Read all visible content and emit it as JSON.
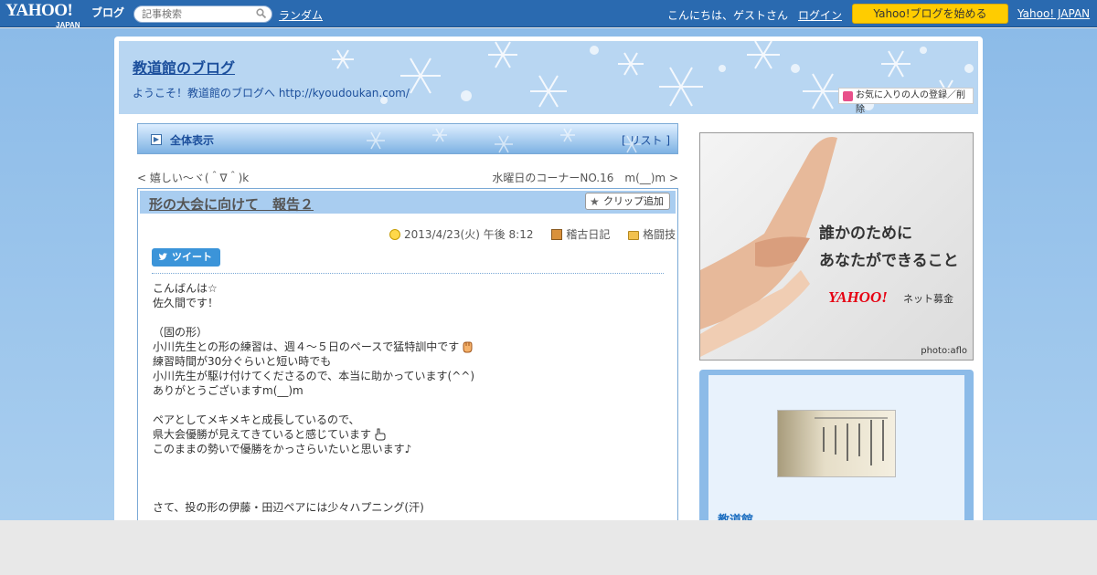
{
  "topbar": {
    "logo": "YAHOO!",
    "logo_sub": "JAPAN",
    "logo_blog": "ブログ",
    "search_placeholder": "記事検索",
    "random_link": "ランダム",
    "greeting": "こんにちは、ゲストさん",
    "login": "ログイン",
    "start_blog": "Yahoo!ブログを始める",
    "yahoo_japan": "Yahoo! JAPAN"
  },
  "header": {
    "blog_title": "教道館のブログ",
    "welcome": "ようこそ！教道館のブログへ http://kyoudoukan.com/",
    "favorite_button": "お気に入りの人の登録／削除"
  },
  "nav": {
    "all_label": "全体表示",
    "list_open": "[ ",
    "list_link": "リスト",
    "list_close": " ]",
    "prev_prefix": "< ",
    "prev_link": "嬉しい～ヾ(＾∇＾)k",
    "next_link": "水曜日のコーナーNO.16　m(__)m",
    "next_suffix": " >"
  },
  "article": {
    "title": "形の大会に向けて　報告２",
    "clip_button": "クリップ追加",
    "date": "2013/4/23(火) 午後 8:12",
    "category": "稽古日記",
    "folder": "格闘技",
    "tweet_button": "ツイート",
    "lines": [
      "こんばんは☆",
      "佐久間です！",
      "",
      "（固の形）",
      "小川先生との形の練習は、週４～５日のペースで猛特訓中です",
      "練習時間が30分ぐらいと短い時でも",
      "小川先生が駆け付けてくださるので、本当に助かっています(^^)",
      "ありがとうございますm(__)m",
      "",
      "ペアとしてメキメキと成長しているので、",
      "県大会優勝が見えてきていると感じています",
      "このままの勢いで優勝をかっさらいたいと思います♪",
      "",
      "",
      "",
      "さて、投の形の伊藤・田辺ペアには少々ハプニング(汗)"
    ]
  },
  "ad": {
    "line1": "誰かのために",
    "line2": "あなたができること",
    "logo": "YAHOO!",
    "logo_sub": "ネット募金",
    "credit": "photo:aflo"
  },
  "profile": {
    "name": "教道館"
  },
  "icons": {
    "search": "search-icon",
    "favorite": "heart-icon",
    "clip": "star-icon",
    "date": "clock-icon",
    "category": "book-icon",
    "folder": "folder-icon",
    "tweet": "twitter-bird-icon"
  },
  "colors": {
    "topbar": "#2a6ab0",
    "accent_button": "#ffcc00",
    "link_blue": "#1c4f9c",
    "tweet": "#3b94d9"
  }
}
